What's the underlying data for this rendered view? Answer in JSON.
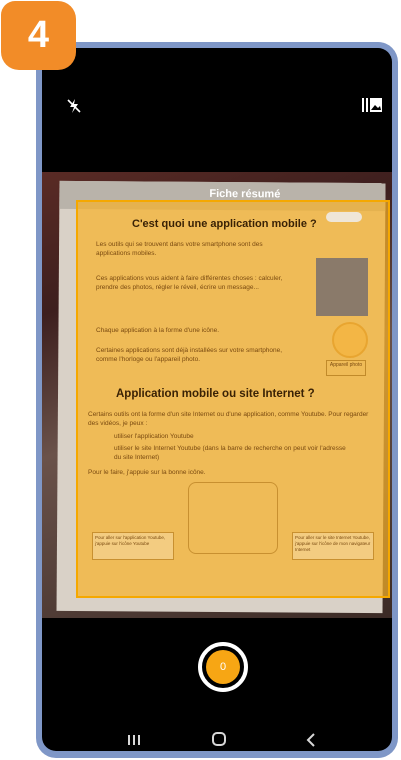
{
  "step": {
    "number": "4"
  },
  "camera": {
    "flash_icon": "flash-off-icon",
    "gallery_icon": "gallery-icon",
    "capture_counter": "0",
    "accent_color": "#f7a614"
  },
  "document": {
    "banner_title": "Fiche résumé",
    "heading_1": "C'est quoi une application mobile ?",
    "paragraph_1": "Les outils qui se trouvent dans votre smartphone sont des applications mobiles.",
    "paragraph_2": "Ces applications vous aident à faire différentes choses : calculer, prendre des photos, régler le réveil, écrire un message...",
    "paragraph_3": "Chaque application à la forme d'une icône.",
    "paragraph_4": "Certaines applications sont déjà installées sur votre smartphone, comme l'horloge ou l'appareil photo.",
    "camera_label": "Appareil photo",
    "heading_2": "Application mobile ou site Internet ?",
    "paragraph_5": "Certains outils ont la forme d'un site Internet ou d'une application, comme Youtube. Pour regarder des vidéos, je peux :",
    "bullet_1": "utiliser l'application Youtube",
    "bullet_2": "utiliser le site Internet Youtube (dans la barre de recherche on peut voir l'adresse du site Internet)",
    "paragraph_6": "Pour le faire, j'appuie sur la bonne icône.",
    "box_left": "Pour aller sur l'application Youtube, j'appuie sur l'icône Youtube",
    "box_right": "Pour aller sur le site Internet Youtube, j'appuie sur l'icône de mon navigateur Internet"
  },
  "nav": {
    "recents_icon": "recents-icon",
    "home_icon": "home-icon",
    "back_icon": "back-icon"
  }
}
